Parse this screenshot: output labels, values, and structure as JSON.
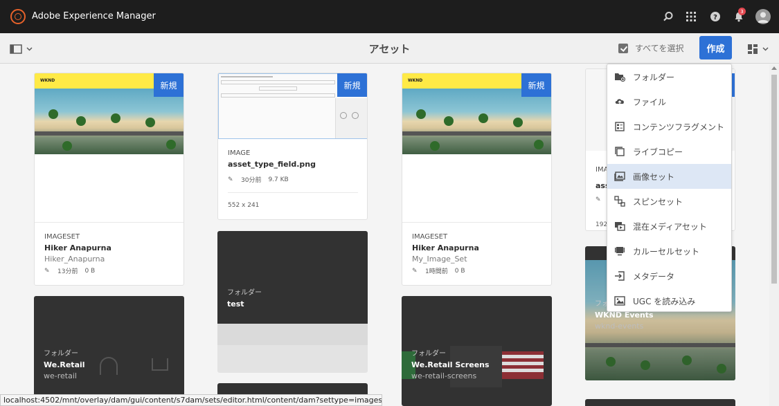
{
  "app": {
    "title": "Adobe Experience Manager",
    "notification_count": "3"
  },
  "actionbar": {
    "page_title": "アセット",
    "select_all_label": "すべてを選択",
    "create_label": "作成"
  },
  "cards": {
    "c1": {
      "badge": "新規",
      "brand": "WKND",
      "type": "IMAGESET",
      "name": "Hiker Anapurna",
      "sub": "Hiker_Anapurna",
      "time": "13分前",
      "size": "0 B"
    },
    "c2": {
      "badge": "新規",
      "type": "IMAGE",
      "name": "asset_type_field.png",
      "time": "30分前",
      "size": "9.7 KB",
      "dimensions": "552 x 241"
    },
    "c3": {
      "badge": "新規",
      "brand": "WKND",
      "type": "IMAGESET",
      "name": "Hiker Anapurna",
      "sub": "My_Image_Set",
      "time": "1時間前",
      "size": "0 B"
    },
    "c4": {
      "badge": "新規",
      "type_partial": "IMA",
      "name_partial": "ass",
      "dim_partial": "192"
    },
    "f1": {
      "type": "フォルダー",
      "name": "test"
    },
    "f2": {
      "type": "フォルダー",
      "name": "We.Retail",
      "sub": "we-retail"
    },
    "f3": {
      "type": "フォルダー",
      "name": "We.Retail Screens",
      "sub": "we-retail-screens"
    },
    "f4": {
      "type": "フォルダー",
      "name": "WKND Events",
      "sub": "wknd-events"
    }
  },
  "menu": {
    "items": [
      {
        "label": "フォルダー",
        "icon": "folder-add-icon"
      },
      {
        "label": "ファイル",
        "icon": "upload-cloud-icon"
      },
      {
        "label": "コンテンツフラグメント",
        "icon": "content-fragment-icon"
      },
      {
        "label": "ライブコピー",
        "icon": "live-copy-icon"
      },
      {
        "label": "画像セット",
        "icon": "image-set-icon",
        "active": true
      },
      {
        "label": "スピンセット",
        "icon": "spin-set-icon"
      },
      {
        "label": "混在メディアセット",
        "icon": "mixed-media-icon"
      },
      {
        "label": "カルーセルセット",
        "icon": "carousel-icon"
      },
      {
        "label": "メタデータ",
        "icon": "metadata-import-icon"
      },
      {
        "label": "UGC を読み込み",
        "icon": "ugc-import-icon"
      }
    ]
  },
  "status_url": "localhost:4502/mnt/overlay/dam/gui/content/s7dam/sets/editor.html/content/dam?settype=imageset"
}
